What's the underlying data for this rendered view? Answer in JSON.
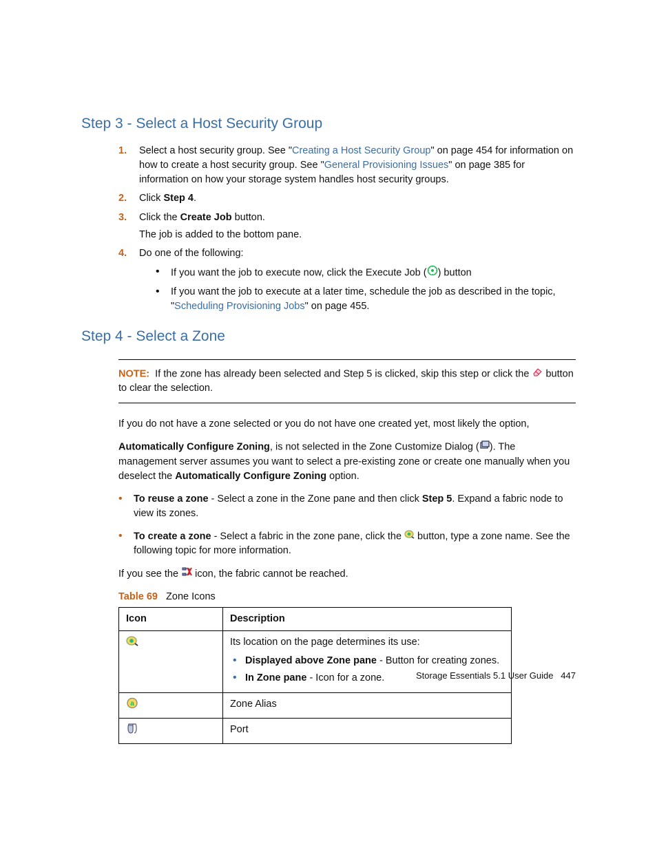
{
  "step3": {
    "heading": "Step 3 - Select a Host Security Group",
    "items": {
      "i1": {
        "pre": "Select a host security group. See \"",
        "link1": "Creating a Host Security Group",
        "mid1": "\" on page 454 for information on how to create a host security group. See \"",
        "link2": "General Provisioning Issues",
        "post": "\" on page 385 for information on how your storage system handles host security groups."
      },
      "i2a": "Click ",
      "i2b": "Step 4",
      "i2c": ".",
      "i3a": "Click the ",
      "i3b": "Create Job",
      "i3c": " button.",
      "i3_sub": "The job is added to the bottom pane.",
      "i4": "Do one of the following:",
      "i4_b1_pre": "If you want the job to execute now, click the Execute Job (",
      "i4_b1_post": ") button",
      "i4_b2_pre": "If you want the job to execute at a later time, schedule the job as described in the topic, \"",
      "i4_b2_link": "Scheduling Provisioning Jobs",
      "i4_b2_post": "\" on page 455."
    }
  },
  "step4": {
    "heading": "Step 4 - Select a Zone",
    "note_label": "NOTE:",
    "note_text_pre": "If the zone has already been selected and Step 5 is clicked, skip this step or click the ",
    "note_text_post": " button to clear the selection.",
    "p1": "If you do not have a zone selected or you do not have one created yet, most likely the option,",
    "p2_strong": "Automatically Configure Zoning",
    "p2_a": ", is not selected in the Zone Customize Dialog (",
    "p2_b": "). The management server assumes you want to select a pre-existing zone or create one manually when you deselect the ",
    "p2_strong2": "Automatically Configure Zoning",
    "p2_c": " option.",
    "b1_label": "To reuse a zone",
    "b1_text_a": " -  Select a zone in the Zone pane and then click ",
    "b1_strong": "Step 5",
    "b1_text_b": ". Expand a fabric node to view its zones.",
    "b2_label": "To create a zone",
    "b2_text_a": " - Select a fabric in the zone pane, click the ",
    "b2_text_b": " button, type a zone name. See the following topic for more information.",
    "p3_a": "If you see the ",
    "p3_b": " icon, the fabric cannot be reached."
  },
  "table": {
    "caption_num": "Table 69",
    "caption_title": "Zone Icons",
    "head_icon": "Icon",
    "head_desc": "Description",
    "r1_lead": "Its location on the page determines its use:",
    "r1_b1_strong": "Displayed above Zone pane",
    "r1_b1_rest": " - Button for creating zones.",
    "r1_b2_strong": "In Zone pane",
    "r1_b2_rest": " - Icon for a zone.",
    "r2": "Zone Alias",
    "r3": "Port"
  },
  "footer": {
    "title": "Storage Essentials 5.1 User Guide",
    "page": "447"
  }
}
